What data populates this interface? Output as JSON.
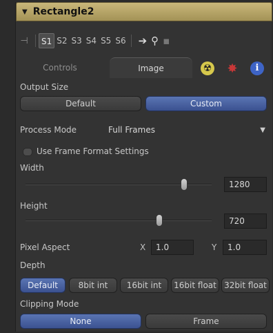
{
  "title": "Rectangle2",
  "toolbar": {
    "slots": [
      "S1",
      "S2",
      "S3",
      "S4",
      "S5",
      "S6"
    ],
    "active_slot": "S1"
  },
  "tabs": {
    "controls": "Controls",
    "image": "Image"
  },
  "output_size": {
    "label": "Output Size",
    "options": [
      "Default",
      "Custom"
    ],
    "selected": "Custom"
  },
  "process_mode": {
    "label": "Process Mode",
    "value": "Full Frames"
  },
  "use_frame_format": {
    "label": "Use Frame Format Settings",
    "checked": false
  },
  "width": {
    "label": "Width",
    "value": "1280",
    "slider_fraction": 0.85
  },
  "height": {
    "label": "Height",
    "value": "720",
    "slider_fraction": 0.72
  },
  "pixel_aspect": {
    "label": "Pixel Aspect",
    "x_label": "X",
    "x_value": "1.0",
    "y_label": "Y",
    "y_value": "1.0"
  },
  "depth": {
    "label": "Depth",
    "options": [
      "Default",
      "8bit int",
      "16bit int",
      "16bit float",
      "32bit float"
    ],
    "selected": "Default"
  },
  "clipping_mode": {
    "label": "Clipping Mode",
    "options": [
      "None",
      "Frame"
    ],
    "selected": "None"
  },
  "colors": {
    "title_bar": "#b5a468",
    "selected_button": "#4a64a6"
  }
}
